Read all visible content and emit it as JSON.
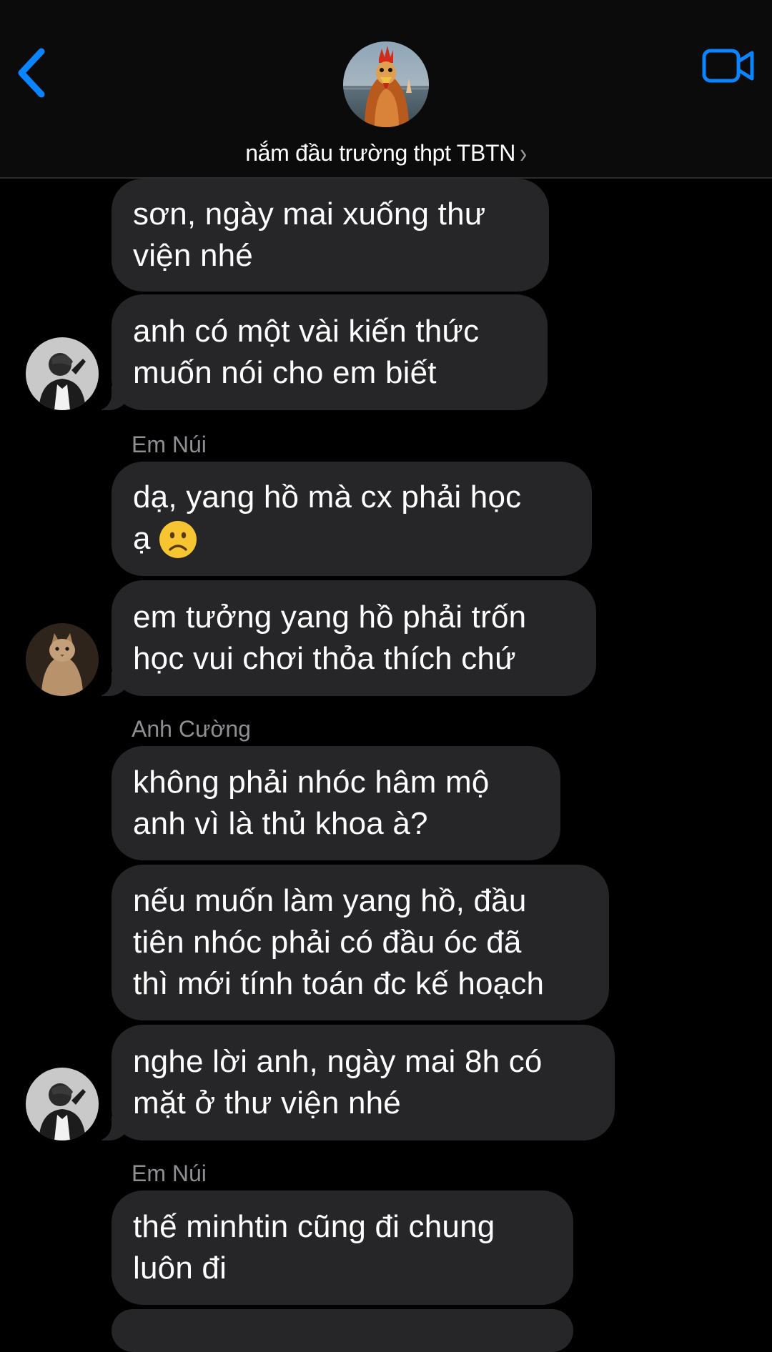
{
  "header": {
    "group_name": "nắm đầu trường thpt TBTN",
    "chevron": "›",
    "back_icon": "chevron-left-icon",
    "video_icon": "video-camera-icon",
    "accent_color": "#0a84ff"
  },
  "messages": [
    {
      "text": "sơn, ngày mai xuống thư\nviện nhé"
    },
    {
      "text": "anh có một vài kiến thức\nmuốn nói cho em biết"
    },
    {
      "sender": "Em Núi"
    },
    {
      "text": "dạ, yang hồ mà cx phải học\nạ"
    },
    {
      "text": "em tưởng yang hồ phải trốn\nhọc vui chơi thỏa thích chứ"
    },
    {
      "sender": "Anh Cường"
    },
    {
      "text": "không phải nhóc hâm mộ\nanh vì là thủ khoa à?"
    },
    {
      "text": "nếu muốn làm yang hồ, đầu\ntiên nhóc phải có đầu óc đã\nthì mới tính toán đc kế hoạch"
    },
    {
      "text": "nghe lời anh, ngày mai 8h có\nmặt ở thư viện nhé"
    },
    {
      "sender": "Em Núi"
    },
    {
      "text": "thế minhtin cũng đi chung\nluôn đi"
    }
  ],
  "colors": {
    "bubble": "#262628",
    "sender_label": "#8e8e93",
    "background": "#000000"
  }
}
